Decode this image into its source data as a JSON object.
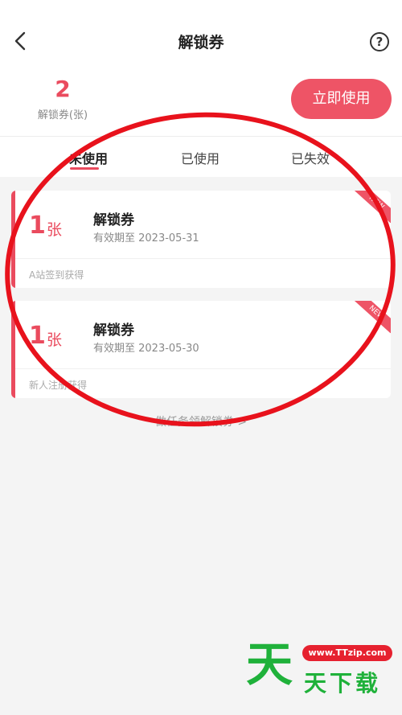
{
  "header": {
    "title": "解锁券",
    "help_glyph": "?"
  },
  "summary": {
    "count": "2",
    "count_label": "解锁券(张)",
    "use_button": "立即使用"
  },
  "tabs": [
    {
      "label": "未使用",
      "active": true
    },
    {
      "label": "已使用",
      "active": false
    },
    {
      "label": "已失效",
      "active": false
    }
  ],
  "coupons": [
    {
      "num": "1",
      "unit": "张",
      "name": "解锁券",
      "validity": "有效期至 2023-05-31",
      "source": "A站签到获得",
      "tag": "NEW"
    },
    {
      "num": "1",
      "unit": "张",
      "name": "解锁券",
      "validity": "有效期至 2023-05-30",
      "source": "新人注册获得",
      "tag": "NEW"
    }
  ],
  "task_link": "做任务领解锁券 >",
  "watermark": {
    "big": "天",
    "url": "www.TTzip.com",
    "text": "天下载"
  },
  "colors": {
    "accent": "#ea4b5e",
    "button": "#ee5466",
    "annotation_circle": "#e8121c",
    "watermark_green": "#1fb13a"
  }
}
